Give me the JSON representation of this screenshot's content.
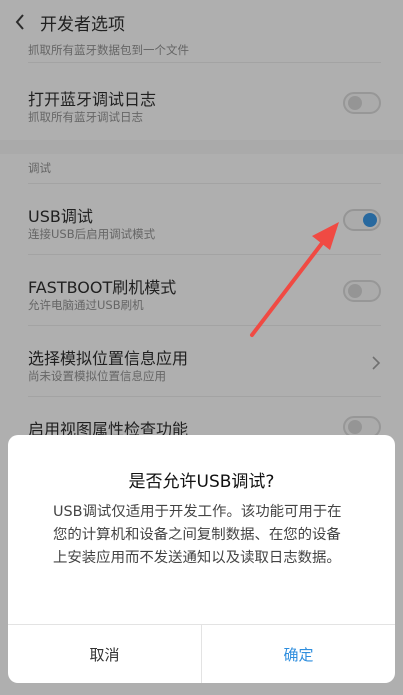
{
  "header": {
    "title": "开发者选项"
  },
  "rows": {
    "partial_top": "抓取所有蓝牙数据包到一个文件",
    "bt_log": {
      "title": "打开蓝牙调试日志",
      "subtitle": "抓取所有蓝牙调试日志"
    },
    "section_debug": "调试",
    "usb_debug": {
      "title": "USB调试",
      "subtitle": "连接USB后启用调试模式"
    },
    "fastboot": {
      "title": "FASTBOOT刷机模式",
      "subtitle": "允许电脑通过USB刷机"
    },
    "mock_location": {
      "title": "选择模拟位置信息应用",
      "subtitle": "尚未设置模拟位置信息应用"
    },
    "view_attr": {
      "title": "启用视图属性检查功能"
    }
  },
  "dialog": {
    "title": "是否允许USB调试?",
    "message": "USB调试仅适用于开发工作。该功能可用于在您的计算机和设备之间复制数据、在您的设备上安装应用而不发送通知以及读取日志数据。",
    "cancel_label": "取消",
    "confirm_label": "确定"
  },
  "colors": {
    "accent": "#2e8ede",
    "arrow": "#f04a43"
  },
  "icons": {
    "back": "chevron-left-icon",
    "chevron": "chevron-right-icon"
  }
}
